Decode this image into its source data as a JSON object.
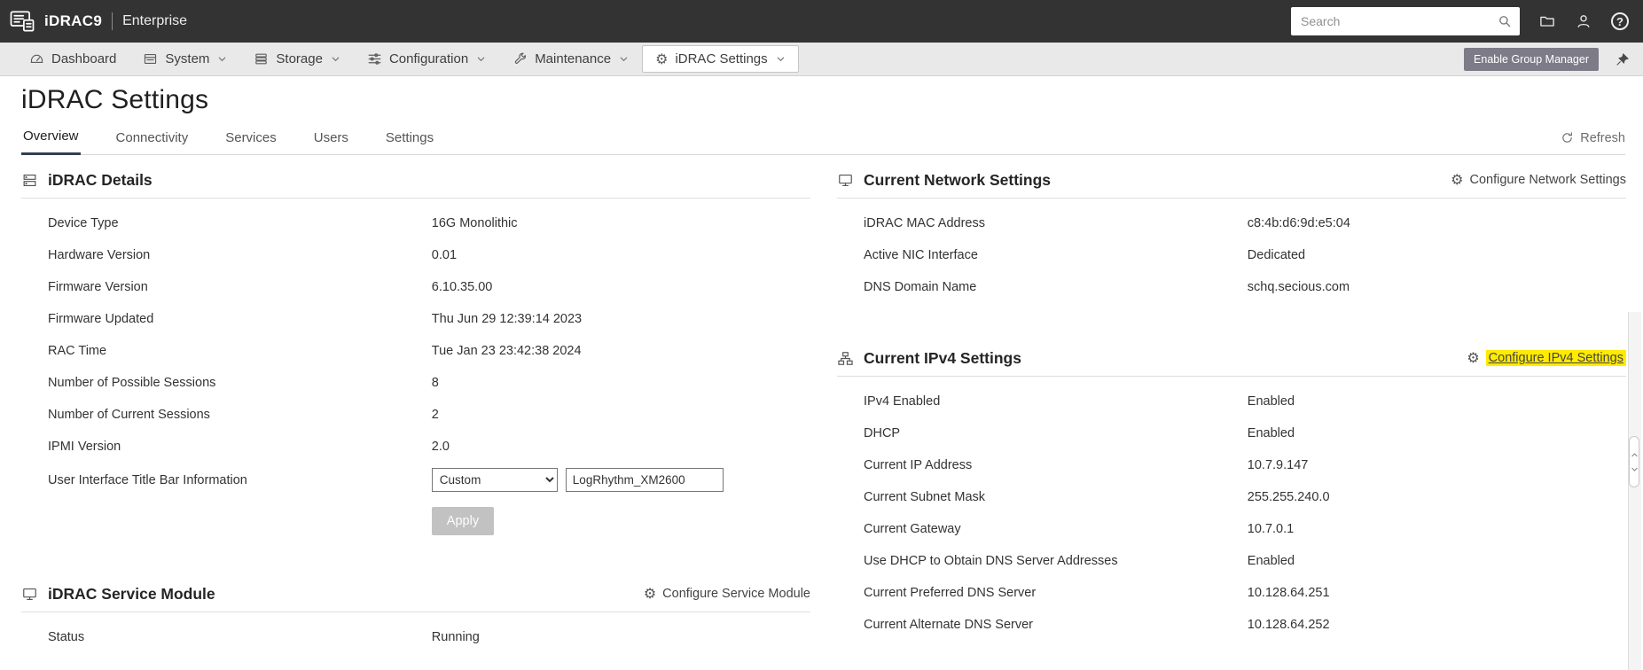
{
  "topbar": {
    "brand": "iDRAC9",
    "edition": "Enterprise",
    "search_placeholder": "Search",
    "help_glyph": "?"
  },
  "nav": {
    "items": [
      {
        "label": "Dashboard"
      },
      {
        "label": "System"
      },
      {
        "label": "Storage"
      },
      {
        "label": "Configuration"
      },
      {
        "label": "Maintenance"
      },
      {
        "label": "iDRAC Settings"
      }
    ],
    "active_item": "iDRAC Settings",
    "group_manager_label": "Enable Group Manager"
  },
  "page": {
    "title": "iDRAC Settings",
    "tabs": [
      "Overview",
      "Connectivity",
      "Services",
      "Users",
      "Settings"
    ],
    "active_tab": "Overview",
    "refresh_label": "Refresh"
  },
  "panels": {
    "idrac_details": {
      "title": "iDRAC Details",
      "rows": [
        {
          "label": "Device Type",
          "value": "16G Monolithic"
        },
        {
          "label": "Hardware Version",
          "value": "0.01"
        },
        {
          "label": "Firmware Version",
          "value": "6.10.35.00"
        },
        {
          "label": "Firmware Updated",
          "value": "Thu Jun 29 12:39:14 2023"
        },
        {
          "label": "RAC Time",
          "value": "Tue Jan 23 23:42:38 2024"
        },
        {
          "label": "Number of Possible Sessions",
          "value": "8"
        },
        {
          "label": "Number of Current Sessions",
          "value": "2"
        },
        {
          "label": "IPMI Version",
          "value": "2.0"
        }
      ],
      "title_bar_row": {
        "label": "User Interface Title Bar Information",
        "select_value": "Custom",
        "input_value": "LogRhythm_XM2600"
      },
      "apply_label": "Apply"
    },
    "service_module": {
      "title": "iDRAC Service Module",
      "action_label": "Configure Service Module",
      "rows": [
        {
          "label": "Status",
          "value": "Running"
        }
      ]
    },
    "network_settings": {
      "title": "Current Network Settings",
      "action_label": "Configure Network Settings",
      "rows": [
        {
          "label": "iDRAC MAC Address",
          "value": "c8:4b:d6:9d:e5:04"
        },
        {
          "label": "Active NIC Interface",
          "value": "Dedicated"
        },
        {
          "label": "DNS Domain Name",
          "value": "schq.secious.com"
        }
      ]
    },
    "ipv4_settings": {
      "title": "Current IPv4 Settings",
      "action_label": "Configure IPv4 Settings",
      "action_highlighted": true,
      "rows": [
        {
          "label": "IPv4 Enabled",
          "value": "Enabled"
        },
        {
          "label": "DHCP",
          "value": "Enabled"
        },
        {
          "label": "Current IP Address",
          "value": "10.7.9.147"
        },
        {
          "label": "Current Subnet Mask",
          "value": "255.255.240.0"
        },
        {
          "label": "Current Gateway",
          "value": "10.7.0.1"
        },
        {
          "label": "Use DHCP to Obtain DNS Server Addresses",
          "value": "Enabled"
        },
        {
          "label": "Current Preferred DNS Server",
          "value": "10.128.64.251"
        },
        {
          "label": "Current Alternate DNS Server",
          "value": "10.128.64.252"
        }
      ]
    }
  },
  "colors": {
    "topbar_bg": "#333333",
    "navbar_bg": "#e9e9e9",
    "group_manager_bg": "#7d7b88",
    "active_tab_underline": "#333f4f",
    "highlight_yellow": "#ffeb00"
  }
}
